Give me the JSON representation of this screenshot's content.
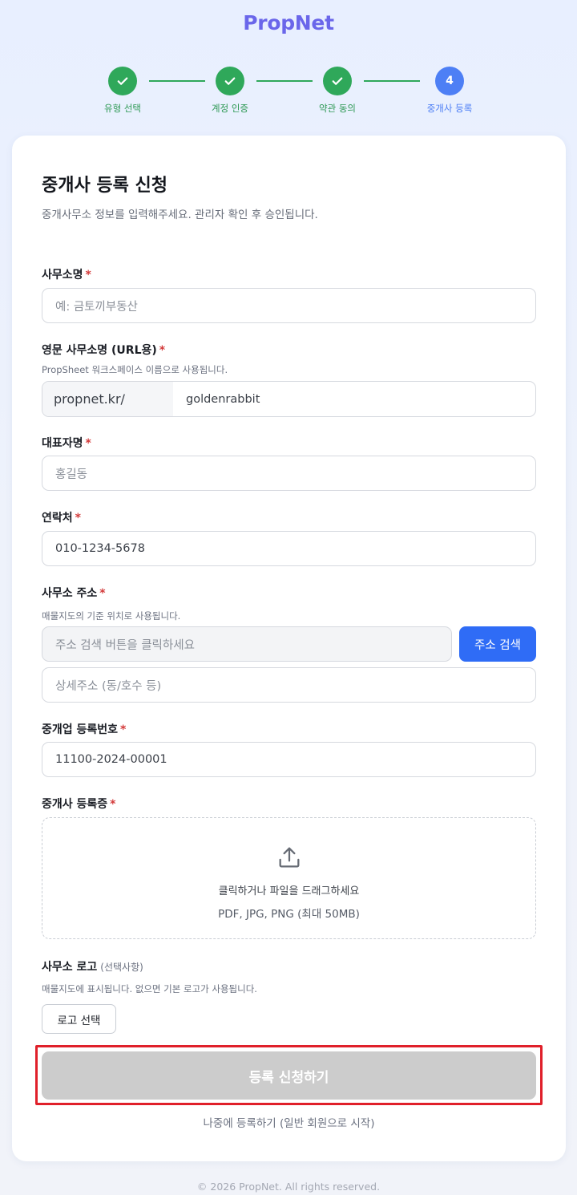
{
  "brand": {
    "name": "PropNet"
  },
  "stepper": {
    "steps": [
      {
        "label": "유형 선택",
        "state": "done"
      },
      {
        "label": "계정 인증",
        "state": "done"
      },
      {
        "label": "약관 동의",
        "state": "done"
      },
      {
        "label": "중개사 등록",
        "state": "current",
        "number": "4"
      }
    ]
  },
  "form": {
    "title": "중개사 등록 신청",
    "subtitle": "중개사무소 정보를 입력해주세요. 관리자 확인 후 승인됩니다.",
    "required_mark": "*",
    "office_name": {
      "label": "사무소명",
      "placeholder": "예: 금토끼부동산"
    },
    "office_name_en": {
      "label": "영문 사무소명 (URL용)",
      "hint": "PropSheet 워크스페이스 이름으로 사용됩니다.",
      "prefix": "propnet.kr/",
      "value": "goldenrabbit"
    },
    "representative": {
      "label": "대표자명",
      "placeholder": "홍길동"
    },
    "phone": {
      "label": "연락처",
      "value": "010-1234-5678"
    },
    "address": {
      "label": "사무소 주소",
      "hint": "매물지도의 기준 위치로 사용됩니다.",
      "placeholder": "주소 검색 버튼을 클릭하세요",
      "search_button": "주소 검색",
      "detail_placeholder": "상세주소 (동/호수 등)"
    },
    "registration_number": {
      "label": "중개업 등록번호",
      "value": "11100-2024-00001"
    },
    "certificate": {
      "label": "중개사 등록증",
      "upload_text": "클릭하거나 파일을 드래그하세요",
      "upload_formats": "PDF, JPG, PNG (최대 50MB)",
      "icon": "upload-icon"
    },
    "logo": {
      "label": "사무소 로고",
      "optional": "(선택사항)",
      "hint": "매물지도에 표시됩니다. 없으면 기본 로고가 사용됩니다.",
      "button": "로고 선택"
    },
    "submit_button": "등록 신청하기",
    "later_link": "나중에 등록하기 (일반 회원으로 시작)"
  },
  "colors": {
    "brand": "#6a66ea",
    "step_done": "#2fa85a",
    "step_current": "#4d7ff5",
    "primary_button": "#2f6cf6",
    "disabled_button": "#cccccc",
    "highlight_frame": "#e0202a",
    "required": "#d33a3a"
  },
  "footer": {
    "copyright": "© 2026 PropNet. All rights reserved."
  }
}
